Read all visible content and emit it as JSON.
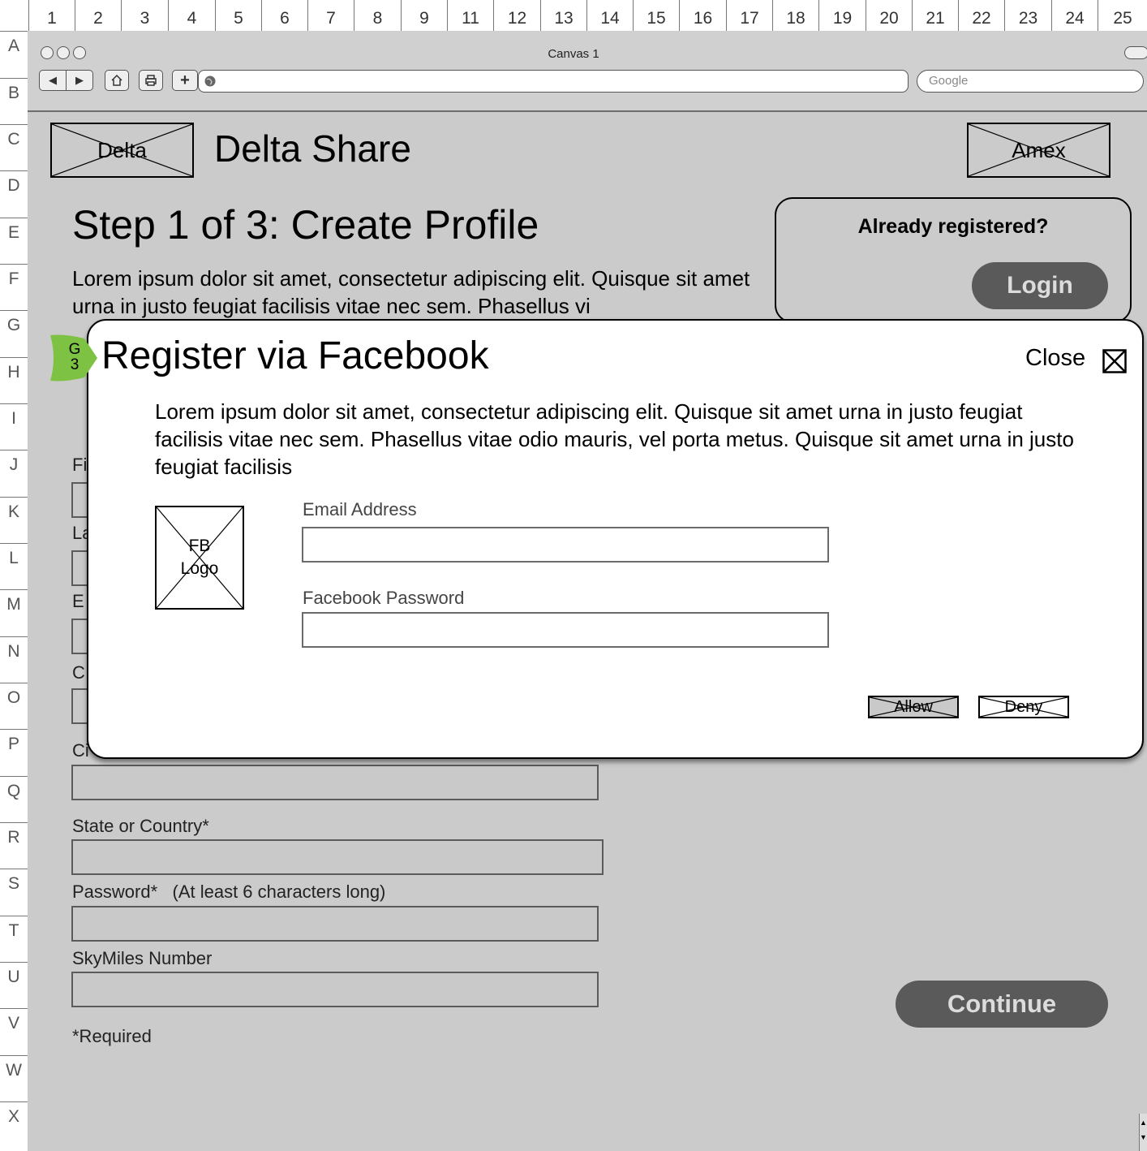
{
  "rulers": {
    "columns": [
      "1",
      "2",
      "3",
      "4",
      "5",
      "6",
      "7",
      "8",
      "9",
      "11",
      "12",
      "13",
      "14",
      "15",
      "16",
      "17",
      "18",
      "19",
      "20",
      "21",
      "22",
      "23",
      "24",
      "25"
    ],
    "rows": [
      "A",
      "B",
      "C",
      "D",
      "E",
      "F",
      "G",
      "H",
      "I",
      "J",
      "K",
      "L",
      "M",
      "N",
      "O",
      "P",
      "Q",
      "R",
      "S",
      "T",
      "U",
      "V",
      "W",
      "X"
    ]
  },
  "browser": {
    "title": "Canvas 1",
    "search_placeholder": "Google"
  },
  "header": {
    "left_logo": "Delta",
    "site_title": "Delta Share",
    "right_logo": "Amex"
  },
  "page": {
    "step_title": "Step 1 of 3: Create Profile",
    "intro": "Lorem ipsum dolor sit amet, consectetur adipiscing elit. Quisque sit amet urna in justo feugiat facilisis vitae nec sem. Phasellus vi",
    "hidden_label_fragments": [
      "Fi",
      "La",
      "E",
      "C",
      "Ci"
    ]
  },
  "login_box": {
    "heading": "Already registered?",
    "button": "Login"
  },
  "form": {
    "fields": [
      {
        "label": "State or Country*"
      },
      {
        "label": "Password*   (At least 6 characters long)"
      },
      {
        "label": "SkyMiles Number"
      }
    ],
    "required_note": "*Required",
    "continue": "Continue"
  },
  "badge": {
    "line1": "G",
    "line2": "3",
    "color": "#7dc242"
  },
  "modal": {
    "title": "Register via Facebook",
    "close": "Close",
    "description": "Lorem ipsum dolor sit amet, consectetur adipiscing elit. Quisque sit amet urna in justo feugiat facilisis vitae nec sem. Phasellus vitae odio mauris, vel porta metus. Quisque sit amet urna in justo feugiat facilisis",
    "logo": "FB Logo",
    "email_label": "Email Address",
    "password_label": "Facebook Password",
    "allow": "Allow",
    "deny": "Deny"
  }
}
